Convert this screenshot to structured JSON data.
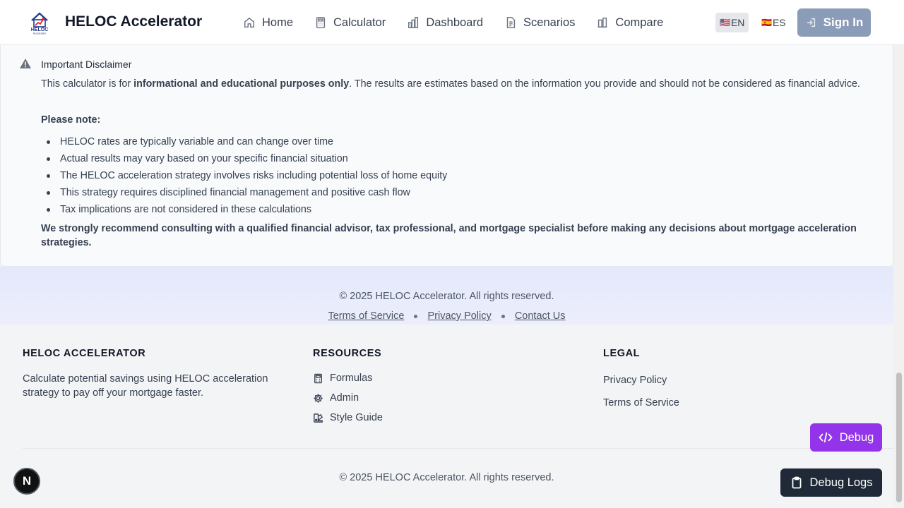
{
  "header": {
    "brand": "HELOC Accelerator",
    "logo_text": "HELOC Accelerator",
    "nav": [
      {
        "label": "Home",
        "icon": "home-icon"
      },
      {
        "label": "Calculator",
        "icon": "calculator-icon"
      },
      {
        "label": "Dashboard",
        "icon": "bar-chart-icon"
      },
      {
        "label": "Scenarios",
        "icon": "document-icon"
      },
      {
        "label": "Compare",
        "icon": "compare-icon"
      }
    ],
    "languages": [
      {
        "code": "EN",
        "flag": "🇺🇸",
        "active": true
      },
      {
        "code": "ES",
        "flag": "🇪🇸",
        "active": false
      }
    ],
    "sign_in": "Sign In"
  },
  "disclaimer": {
    "title": "Important Disclaimer",
    "intro_before": "This calculator is for ",
    "intro_bold": "informational and educational purposes only",
    "intro_after": ". The results are estimates based on the information you provide and should not be considered as financial advice.",
    "note_label": "Please note:",
    "items": [
      "HELOC rates are typically variable and can change over time",
      "Actual results may vary based on your specific financial situation",
      "The HELOC acceleration strategy involves risks including potential loss of home equity",
      "This strategy requires disciplined financial management and positive cash flow",
      "Tax implications are not considered in these calculations"
    ],
    "recommendation": "We strongly recommend consulting with a qualified financial advisor, tax professional, and mortgage specialist before making any decisions about mortgage acceleration strategies."
  },
  "band": {
    "copyright": "© 2025 HELOC Accelerator. All rights reserved.",
    "links": [
      "Terms of Service",
      "Privacy Policy",
      "Contact Us"
    ]
  },
  "footer": {
    "about": {
      "title": "HELOC ACCELERATOR",
      "description": "Calculate potential savings using HELOC acceleration strategy to pay off your mortgage faster."
    },
    "resources": {
      "title": "RESOURCES",
      "items": [
        {
          "label": "Formulas",
          "icon": "calculator-icon"
        },
        {
          "label": "Admin",
          "icon": "gear-icon"
        },
        {
          "label": "Style Guide",
          "icon": "palette-icon"
        }
      ]
    },
    "legal": {
      "title": "LEGAL",
      "items": [
        "Privacy Policy",
        "Terms of Service"
      ]
    },
    "copyright": "© 2025 HELOC Accelerator. All rights reserved."
  },
  "floating": {
    "next_badge": "N",
    "debug": "Debug",
    "debug_logs": "Debug Logs"
  },
  "colors": {
    "debug_purple": "#9333ea",
    "sign_in_bg": "#8b9cb8",
    "logs_dark": "#1f2937"
  }
}
